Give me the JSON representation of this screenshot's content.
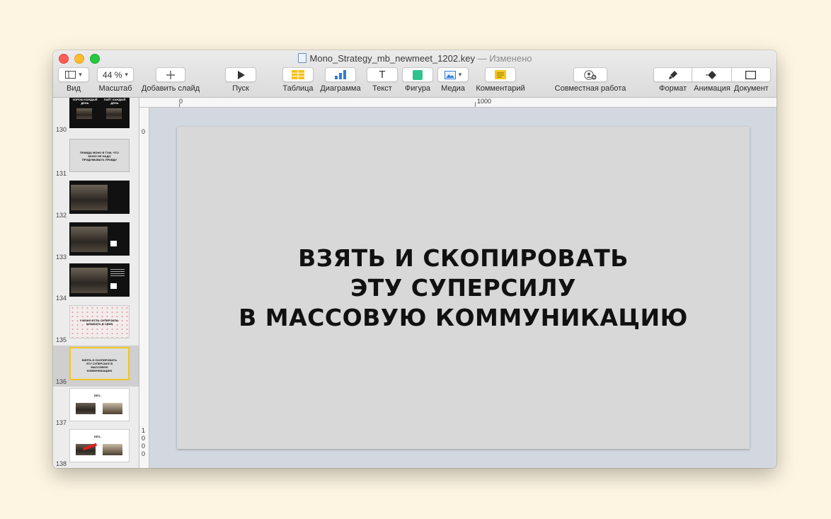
{
  "window": {
    "filename": "Mono_Strategy_mb_newmeet_1202.key",
    "status": "— Изменено"
  },
  "toolbar": {
    "view": "Вид",
    "zoom_value": "44 %",
    "zoom": "Масштаб",
    "add_slide": "Добавить слайд",
    "play": "Пуск",
    "table": "Таблица",
    "chart": "Диаграмма",
    "text": "Текст",
    "shape": "Фигура",
    "media": "Медиа",
    "comment": "Комментарий",
    "collaborate": "Совместная работа",
    "format": "Формат",
    "animate": "Анимация",
    "document": "Документ",
    "text_glyph": "T"
  },
  "rulers": {
    "top_0": "0",
    "top_1000": "1000",
    "left_0": "0",
    "left_1000": [
      "1",
      "0",
      "0",
      "0"
    ]
  },
  "slides": [
    {
      "num": "130",
      "style": "dark",
      "text_left": "ХОРОШ КАЖДЫЙ ДЕНЬ",
      "text_right": "ЛАЙТ КАЖДЫЙ ДЕНЬ"
    },
    {
      "num": "131",
      "style": "grey",
      "text": "ПРАВДА МОНО В ТОМ, ЧТО МОНО НЕ НАДО ПРИДУМЫВАТЬ ПРАВДУ"
    },
    {
      "num": "132",
      "style": "dark",
      "text": ""
    },
    {
      "num": "133",
      "style": "dark",
      "text": ""
    },
    {
      "num": "134",
      "style": "dark",
      "text": ""
    },
    {
      "num": "135",
      "style": "pink",
      "text": "У МОНО ЕСТЬ СУПЕРСИЛА: ВЛЮБИТЬ В СЕБЯ"
    },
    {
      "num": "136",
      "style": "sel",
      "text": "ВЗЯТЬ И СКОПИРОВАТЬ ЭТУ СУПЕРСИЛУ В МАССОВУЮ КОММУНИКАЦИЮ"
    },
    {
      "num": "137",
      "style": "white",
      "text": "БЕЗ..."
    },
    {
      "num": "138",
      "style": "white",
      "text": "БЕЗ..."
    }
  ],
  "current_slide": {
    "line1": "ВЗЯТЬ И СКОПИРОВАТЬ",
    "line2": "ЭТУ СУПЕРСИЛУ",
    "line3": "В МАССОВУЮ КОММУНИКАЦИЮ"
  },
  "colors": {
    "accent_selected": "#f3c623",
    "desktop_bg": "#fdf5e1"
  }
}
